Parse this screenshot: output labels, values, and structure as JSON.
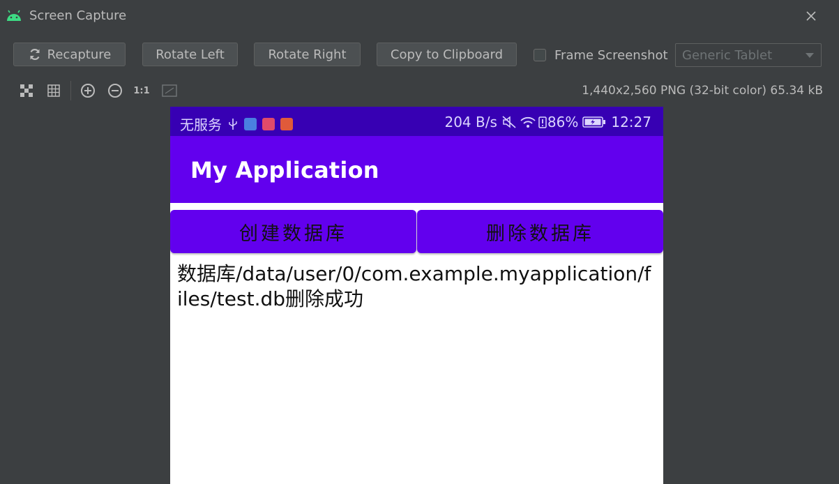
{
  "window": {
    "title": "Screen Capture"
  },
  "toolbar": {
    "recapture": "Recapture",
    "rotate_left": "Rotate Left",
    "rotate_right": "Rotate Right",
    "copy": "Copy to Clipboard",
    "frame_label": "Frame Screenshot",
    "frame_checked": false,
    "device_select": "Generic Tablet"
  },
  "view_tools": {
    "actual_size": "1:1",
    "image_info": "1,440x2,560 PNG (32-bit color) 65.34 kB"
  },
  "device": {
    "status_bar": {
      "carrier": "无服务",
      "net_speed": "204 B/s",
      "battery": "86%",
      "time": "12:27"
    },
    "app_title": "My Application",
    "buttons": {
      "create": "创建数据库",
      "delete": "删除数据库"
    },
    "message": "数据库/data/user/0/com.example.myapplication/files/test.db删除成功"
  },
  "colors": {
    "ide_background": "#3c3f41",
    "status_bar": "#3700b3",
    "app_bar": "#6200ee",
    "android_green": "#3ddc84"
  }
}
